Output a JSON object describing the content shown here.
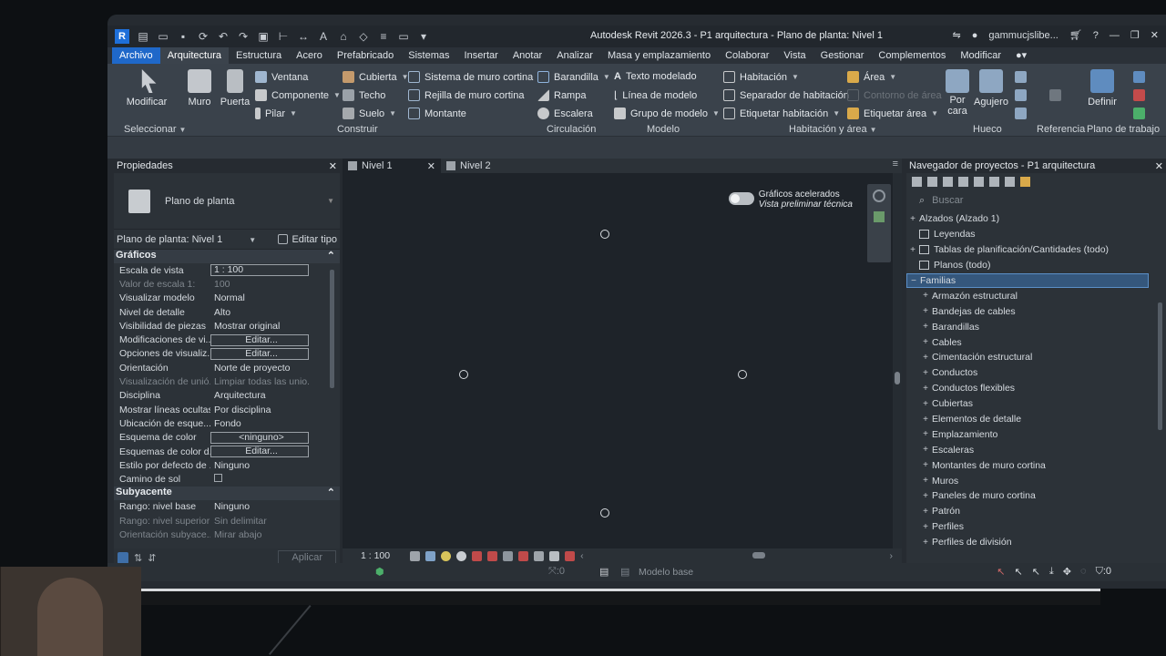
{
  "window": {
    "title": "Autodesk Revit 2026.3 - P1 arquitectura - Plano de planta: Nivel 1",
    "user": "gammucjslibe...",
    "app_badge": "R"
  },
  "menu_tabs": [
    {
      "label": "Archivo"
    },
    {
      "label": "Arquitectura"
    },
    {
      "label": "Estructura"
    },
    {
      "label": "Acero"
    },
    {
      "label": "Prefabricado"
    },
    {
      "label": "Sistemas"
    },
    {
      "label": "Insertar"
    },
    {
      "label": "Anotar"
    },
    {
      "label": "Analizar"
    },
    {
      "label": "Masa y emplazamiento"
    },
    {
      "label": "Colaborar"
    },
    {
      "label": "Vista"
    },
    {
      "label": "Gestionar"
    },
    {
      "label": "Complementos"
    },
    {
      "label": "Modificar"
    }
  ],
  "ribbon": {
    "modificar": "Modificar",
    "muro": "Muro",
    "puerta": "Puerta",
    "ventana": "Ventana",
    "componente": "Componente",
    "pilar": "Pilar",
    "cubierta": "Cubierta",
    "techo": "Techo",
    "suelo": "Suelo",
    "sistema_muro_cortina": "Sistema de muro cortina",
    "rejilla_muro_cortina": "Rejilla de muro cortina",
    "montante": "Montante",
    "barandilla": "Barandilla",
    "rampa": "Rampa",
    "escalera": "Escalera",
    "texto_modelado": "Texto modelado",
    "linea_modelo": "Línea de modelo",
    "grupo_modelo": "Grupo de modelo",
    "habitacion": "Habitación",
    "separador_habitacion": "Separador de habitación",
    "etiquetar_habitacion": "Etiquetar  habitación",
    "area": "Área",
    "contorno_area": "Contorno  de área",
    "etiquetar_area": "Etiquetar  área",
    "por_cara_1": "Por",
    "por_cara_2": "cara",
    "agujero": "Agujero",
    "definir": "Definir",
    "panels": {
      "seleccionar": "Seleccionar",
      "construir": "Construir",
      "circulacion": "Circulación",
      "modelo": "Modelo",
      "habitacion_area": "Habitación y área",
      "hueco": "Hueco",
      "referencia": "Referencia",
      "plano_trabajo": "Plano de trabajo"
    }
  },
  "properties": {
    "title": "Propiedades",
    "type_name": "Plano de planta",
    "view_selector": "Plano de planta: Nivel 1",
    "edit_type": "Editar tipo",
    "graphics_header": "Gráficos",
    "rows": [
      {
        "name": "Escala de vista",
        "value": "1 : 100"
      },
      {
        "name": "Valor de escala    1:",
        "value": "100"
      },
      {
        "name": "Visualizar modelo",
        "value": "Normal"
      },
      {
        "name": "Nivel de detalle",
        "value": "Alto"
      },
      {
        "name": "Visibilidad de piezas",
        "value": "Mostrar original"
      },
      {
        "name": "Modificaciones de vi...",
        "value": "Editar..."
      },
      {
        "name": "Opciones de visualiz...",
        "value": "Editar..."
      },
      {
        "name": "Orientación",
        "value": "Norte de proyecto"
      },
      {
        "name": "Visualización de unió...",
        "value": "Limpiar todas las unio..."
      },
      {
        "name": "Disciplina",
        "value": "Arquitectura"
      },
      {
        "name": "Mostrar líneas ocultas",
        "value": "Por disciplina"
      },
      {
        "name": "Ubicación de esque...",
        "value": "Fondo"
      },
      {
        "name": "Esquema de color",
        "value": "<ninguno>"
      },
      {
        "name": "Esquemas de color d...",
        "value": "Editar..."
      },
      {
        "name": "Estilo por defecto de ...",
        "value": "Ninguno"
      },
      {
        "name": "Camino de sol",
        "value": ""
      }
    ],
    "underlay_header": "Subyacente",
    "underlay_rows": [
      {
        "name": "Rango: nivel base",
        "value": "Ninguno"
      },
      {
        "name": "Rango: nivel superior",
        "value": "Sin delimitar"
      },
      {
        "name": "Orientación subyace...",
        "value": "Mirar abajo"
      }
    ],
    "apply": "Aplicar"
  },
  "view_tabs": [
    {
      "label": "Nivel 1"
    },
    {
      "label": "Nivel 2"
    }
  ],
  "canvas": {
    "accel_label": "Gráficos acelerados",
    "accel_sub": "Vista preliminar técnica"
  },
  "view_control": {
    "scale": "1 : 100"
  },
  "browser": {
    "title": "Navegador de proyectos - P1 arquitectura",
    "search_placeholder": "Buscar",
    "items": [
      {
        "label": "Alzados (Alzado 1)",
        "exp": "+",
        "level": 1
      },
      {
        "label": "Leyendas",
        "exp": "",
        "level": 1
      },
      {
        "label": "Tablas de planificación/Cantidades (todo)",
        "exp": "+",
        "level": 1
      },
      {
        "label": "Planos (todo)",
        "exp": "",
        "level": 1
      },
      {
        "label": "Familias",
        "exp": "−",
        "level": 1
      },
      {
        "label": "Armazón estructural",
        "exp": "+",
        "level": 2
      },
      {
        "label": "Bandejas de cables",
        "exp": "+",
        "level": 2
      },
      {
        "label": "Barandillas",
        "exp": "+",
        "level": 2
      },
      {
        "label": "Cables",
        "exp": "+",
        "level": 2
      },
      {
        "label": "Cimentación estructural",
        "exp": "+",
        "level": 2
      },
      {
        "label": "Conductos",
        "exp": "+",
        "level": 2
      },
      {
        "label": "Conductos flexibles",
        "exp": "+",
        "level": 2
      },
      {
        "label": "Cubiertas",
        "exp": "+",
        "level": 2
      },
      {
        "label": "Elementos de detalle",
        "exp": "+",
        "level": 2
      },
      {
        "label": "Emplazamiento",
        "exp": "+",
        "level": 2
      },
      {
        "label": "Escaleras",
        "exp": "+",
        "level": 2
      },
      {
        "label": "Montantes de muro cortina",
        "exp": "+",
        "level": 2
      },
      {
        "label": "Muros",
        "exp": "+",
        "level": 2
      },
      {
        "label": "Paneles de muro cortina",
        "exp": "+",
        "level": 2
      },
      {
        "label": "Patrón",
        "exp": "+",
        "level": 2
      },
      {
        "label": "Perfiles",
        "exp": "+",
        "level": 2
      },
      {
        "label": "Perfiles de división",
        "exp": "+",
        "level": 2
      }
    ]
  },
  "statusbar": {
    "workset": "Modelo base",
    "zero_a": ":0",
    "filter_count": ":0"
  },
  "colors": {
    "accent": "#1f68c9",
    "selection": "#35577c"
  }
}
